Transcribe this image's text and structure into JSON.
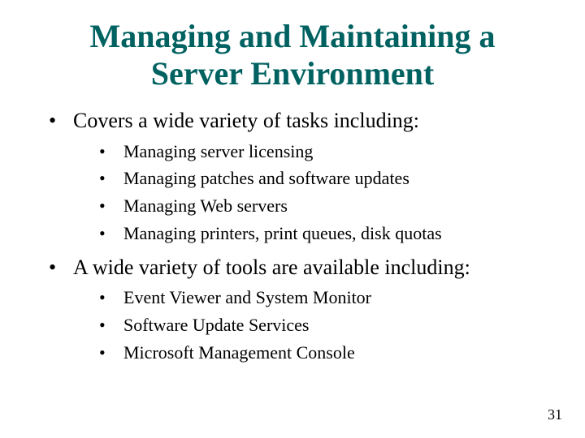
{
  "title_line1": "Managing and Maintaining a",
  "title_line2": "Server Environment",
  "bullets": [
    {
      "text": "Covers a wide variety of tasks including:",
      "sub": [
        "Managing server licensing",
        "Managing patches and software updates",
        "Managing Web servers",
        "Managing printers, print queues, disk quotas"
      ]
    },
    {
      "text": "A wide variety of tools are available including:",
      "sub": [
        "Event Viewer and System Monitor",
        "Software Update Services",
        "Microsoft Management Console"
      ]
    }
  ],
  "page_number": "31"
}
